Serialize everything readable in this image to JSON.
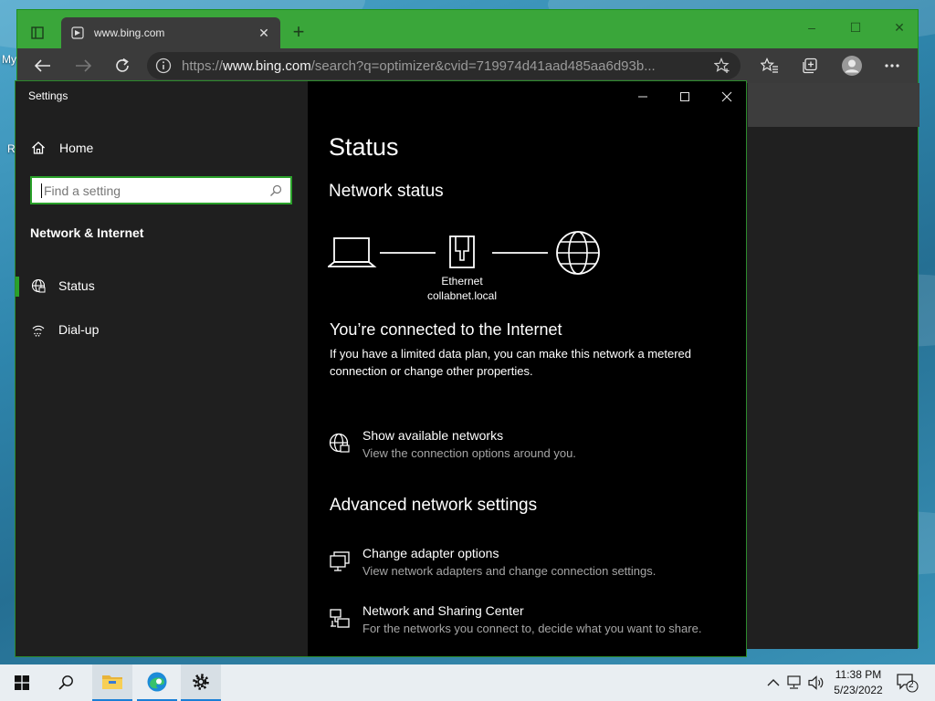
{
  "desktop": {
    "icon_labels": [
      "My",
      "R"
    ]
  },
  "browser": {
    "tab_title": "www.bing.com",
    "new_tab_symbol": "+",
    "address": {
      "scheme": "https://",
      "host": "www.bing.com",
      "path": "/search?q=optimizer&cvid=719974d41aad485aa6d93b..."
    },
    "window_controls": {
      "minimize": "–",
      "maximize": "☐",
      "close": "✕"
    },
    "toolbar_icons": [
      "back-arrow-icon",
      "forward-arrow-icon",
      "refresh-icon",
      "favorites-star-icon",
      "collections-icon",
      "profile-icon",
      "more-icon"
    ],
    "accent_color": "#3aa63a"
  },
  "settings": {
    "window_title": "Settings",
    "home_label": "Home",
    "search_placeholder": "Find a setting",
    "section_label": "Network & Internet",
    "nav": [
      {
        "label": "Status",
        "icon": "globe-icon",
        "selected": true
      },
      {
        "label": "Dial-up",
        "icon": "dialup-icon",
        "selected": false
      }
    ],
    "page_title": "Status",
    "network_status_heading": "Network status",
    "diagram": {
      "adapter_name": "Ethernet",
      "network_name": "collabnet.local"
    },
    "connected_heading": "You’re connected to the Internet",
    "connected_description": "If you have a limited data plan, you can make this network a metered connection or change other properties.",
    "show_networks": {
      "title": "Show available networks",
      "description": "View the connection options around you."
    },
    "advanced_heading": "Advanced network settings",
    "adapter_options": {
      "title": "Change adapter options",
      "description": "View network adapters and change connection settings."
    },
    "sharing_center": {
      "title": "Network and Sharing Center",
      "description": "For the networks you connect to, decide what you want to share."
    },
    "accent_color": "#2aa12a"
  },
  "taskbar": {
    "items": [
      "start-icon",
      "search-icon",
      "file-explorer-icon",
      "edge-icon",
      "settings-gear-icon"
    ],
    "clock_time": "11:38 PM",
    "clock_date": "5/23/2022",
    "notification_count": "2"
  }
}
